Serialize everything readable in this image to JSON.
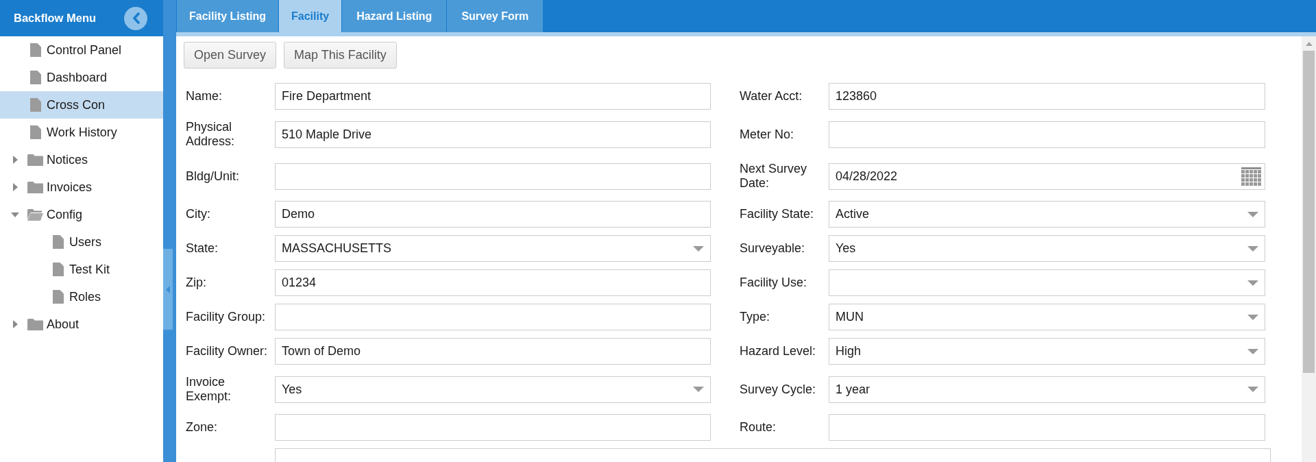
{
  "sidebar": {
    "title": "Backflow Menu",
    "items": [
      {
        "label": "Control Panel",
        "kind": "page",
        "selected": false
      },
      {
        "label": "Dashboard",
        "kind": "page",
        "selected": false
      },
      {
        "label": "Cross Con",
        "kind": "page",
        "selected": true
      },
      {
        "label": "Work History",
        "kind": "page",
        "selected": false
      },
      {
        "label": "Notices",
        "kind": "folder",
        "expanded": false,
        "selected": false
      },
      {
        "label": "Invoices",
        "kind": "folder",
        "expanded": false,
        "selected": false
      },
      {
        "label": "Config",
        "kind": "folder",
        "expanded": true,
        "selected": false,
        "children": [
          {
            "label": "Users",
            "kind": "page",
            "selected": false
          },
          {
            "label": "Test Kit",
            "kind": "page",
            "selected": false
          },
          {
            "label": "Roles",
            "kind": "page",
            "selected": false
          }
        ]
      },
      {
        "label": "About",
        "kind": "folder",
        "expanded": false,
        "selected": false
      }
    ]
  },
  "tabs": [
    {
      "label": "Facility Listing",
      "selected": false
    },
    {
      "label": "Facility",
      "selected": true
    },
    {
      "label": "Hazard Listing",
      "selected": false
    },
    {
      "label": "Survey Form",
      "selected": false
    }
  ],
  "toolbar": {
    "buttons": [
      "Open Survey",
      "Map This Facility"
    ]
  },
  "form": {
    "rows": [
      {
        "left": {
          "label": "Name:",
          "kind": "text",
          "value": "Fire Department"
        },
        "right": {
          "label": "Water Acct:",
          "kind": "text",
          "value": "123860"
        }
      },
      {
        "left": {
          "label": "Physical Address:",
          "kind": "text",
          "value": "510 Maple Drive"
        },
        "right": {
          "label": "Meter No:",
          "kind": "text"
        }
      },
      {
        "left": {
          "label": "Bldg/Unit:",
          "kind": "text"
        },
        "right": {
          "label": "Next Survey Date:",
          "kind": "date",
          "value": "04/28/2022"
        }
      },
      {
        "left": {
          "label": "City:",
          "kind": "text",
          "value": "Demo"
        },
        "right": {
          "label": "Facility State:",
          "kind": "select",
          "value": "Active"
        }
      },
      {
        "left": {
          "label": "State:",
          "kind": "select",
          "value": "MASSACHUSETTS"
        },
        "right": {
          "label": "Surveyable:",
          "kind": "select",
          "value": "Yes"
        }
      },
      {
        "left": {
          "label": "Zip:",
          "kind": "text",
          "value": "01234"
        },
        "right": {
          "label": "Facility Use:",
          "kind": "select"
        }
      },
      {
        "left": {
          "label": "Facility Group:",
          "kind": "text"
        },
        "right": {
          "label": "Type:",
          "kind": "select",
          "value": "MUN"
        }
      },
      {
        "left": {
          "label": "Facility Owner:",
          "kind": "text",
          "value": "Town of Demo"
        },
        "right": {
          "label": "Hazard Level:",
          "kind": "select",
          "value": "High"
        }
      },
      {
        "left": {
          "label": "Invoice Exempt:",
          "kind": "select",
          "value": "Yes"
        },
        "right": {
          "label": "Survey Cycle:",
          "kind": "select",
          "value": "1 year"
        }
      },
      {
        "left": {
          "label": "Zone:",
          "kind": "text"
        },
        "right": {
          "label": "Route:",
          "kind": "text"
        }
      },
      {
        "full": {
          "kind": "textarea"
        }
      }
    ]
  }
}
